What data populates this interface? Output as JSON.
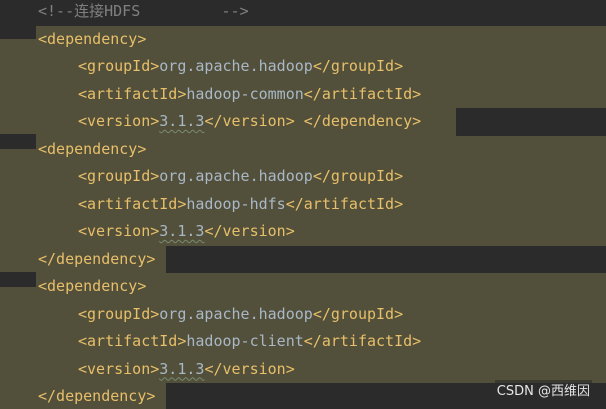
{
  "lines": [
    {
      "indent": "",
      "parts": [
        {
          "cls": "tok-comment",
          "text": "<!--连接HDFS         -->"
        }
      ]
    },
    {
      "indent": "",
      "parts": [
        {
          "cls": "tok-tag",
          "text": "<dependency>"
        }
      ]
    },
    {
      "indent": "    ",
      "parts": [
        {
          "cls": "tok-tag",
          "text": "<groupId>"
        },
        {
          "cls": "tok-text",
          "text": "org.apache.hadoop"
        },
        {
          "cls": "tok-tag",
          "text": "</groupId>"
        }
      ]
    },
    {
      "indent": "    ",
      "parts": [
        {
          "cls": "tok-tag",
          "text": "<artifactId>"
        },
        {
          "cls": "tok-text",
          "text": "hadoop-common"
        },
        {
          "cls": "tok-tag",
          "text": "</artifactId>"
        }
      ]
    },
    {
      "indent": "    ",
      "parts": [
        {
          "cls": "tok-tag",
          "text": "<version>"
        },
        {
          "cls": "tok-ver",
          "text": "3.1.3"
        },
        {
          "cls": "tok-tag",
          "text": "</version>"
        },
        {
          "cls": "tok-text",
          "text": " "
        },
        {
          "cls": "tok-tag",
          "text": "</dependency>"
        }
      ]
    },
    {
      "indent": "",
      "parts": [
        {
          "cls": "tok-tag",
          "text": "<dependency>"
        }
      ]
    },
    {
      "indent": "    ",
      "parts": [
        {
          "cls": "tok-tag",
          "text": "<groupId>"
        },
        {
          "cls": "tok-text",
          "text": "org.apache.hadoop"
        },
        {
          "cls": "tok-tag",
          "text": "</groupId>"
        }
      ]
    },
    {
      "indent": "    ",
      "parts": [
        {
          "cls": "tok-tag",
          "text": "<artifactId>"
        },
        {
          "cls": "tok-text",
          "text": "hadoop-hdfs"
        },
        {
          "cls": "tok-tag",
          "text": "</artifactId>"
        }
      ]
    },
    {
      "indent": "    ",
      "parts": [
        {
          "cls": "tok-tag",
          "text": "<version>"
        },
        {
          "cls": "tok-ver",
          "text": "3.1.3"
        },
        {
          "cls": "tok-tag",
          "text": "</version>"
        }
      ]
    },
    {
      "indent": "",
      "parts": [
        {
          "cls": "tok-tag",
          "text": "</dependency>"
        }
      ]
    },
    {
      "indent": "",
      "parts": [
        {
          "cls": "tok-tag",
          "text": "<dependency>"
        }
      ]
    },
    {
      "indent": "    ",
      "parts": [
        {
          "cls": "tok-tag",
          "text": "<groupId>"
        },
        {
          "cls": "tok-text",
          "text": "org.apache.hadoop"
        },
        {
          "cls": "tok-tag",
          "text": "</groupId>"
        }
      ]
    },
    {
      "indent": "    ",
      "parts": [
        {
          "cls": "tok-tag",
          "text": "<artifactId>"
        },
        {
          "cls": "tok-text",
          "text": "hadoop-client"
        },
        {
          "cls": "tok-tag",
          "text": "</artifactId>"
        }
      ]
    },
    {
      "indent": "    ",
      "parts": [
        {
          "cls": "tok-tag",
          "text": "<version>"
        },
        {
          "cls": "tok-ver",
          "text": "3.1.3"
        },
        {
          "cls": "tok-tag",
          "text": "</version>"
        }
      ]
    },
    {
      "indent": "",
      "parts": [
        {
          "cls": "tok-tag",
          "text": "</dependency>"
        }
      ]
    }
  ],
  "watermark": "CSDN @西维因",
  "colors": {
    "background": "#2b2b2b",
    "highlight": "#52503a",
    "tag": "#e8bf6a",
    "text": "#a9b7c6",
    "comment": "#808080"
  }
}
